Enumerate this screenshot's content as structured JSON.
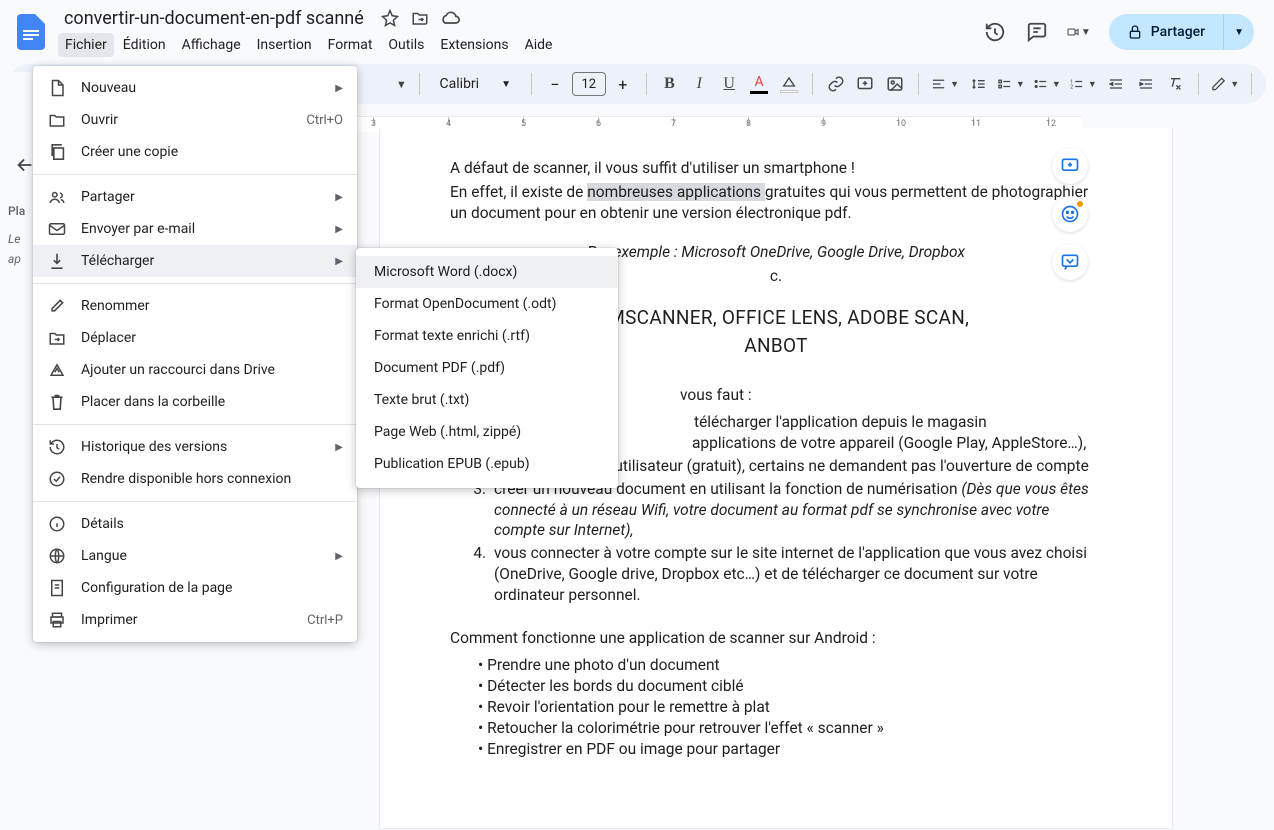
{
  "doc": {
    "title": "convertir-un-document-en-pdf scanné"
  },
  "menubar": [
    "Fichier",
    "Édition",
    "Affichage",
    "Insertion",
    "Format",
    "Outils",
    "Extensions",
    "Aide"
  ],
  "share": {
    "label": "Partager"
  },
  "toolbar": {
    "font": "Calibri",
    "size": "12"
  },
  "leftPanel": {
    "header": "Pla",
    "line1": "Le",
    "line2": "ap"
  },
  "fileMenu": {
    "new": "Nouveau",
    "open": "Ouvrir",
    "open_sc": "Ctrl+O",
    "copy": "Créer une copie",
    "share": "Partager",
    "email": "Envoyer par e-mail",
    "download": "Télécharger",
    "rename": "Renommer",
    "move": "Déplacer",
    "shortcut": "Ajouter un raccourci dans Drive",
    "trash": "Placer dans la corbeille",
    "versions": "Historique des versions",
    "offline": "Rendre disponible hors connexion",
    "details": "Détails",
    "language": "Langue",
    "page_setup": "Configuration de la page",
    "print": "Imprimer",
    "print_sc": "Ctrl+P"
  },
  "downloadMenu": {
    "docx": "Microsoft Word (.docx)",
    "odt": "Format OpenDocument (.odt)",
    "rtf": "Format texte enrichi (.rtf)",
    "pdf": "Document PDF (.pdf)",
    "txt": "Texte brut (.txt)",
    "html": "Page Web (.html, zippé)",
    "epub": "Publication EPUB (.epub)"
  },
  "doc_content": {
    "p1": "A défaut de scanner, il vous suffit d'utiliser un smartphone !",
    "p2a": "En effet, il existe de ",
    "p2b": "nombreuses applications ",
    "p2c": "gratuites qui vous permettent de photographier un document pour en obtenir une version électronique pdf.",
    "example": "Par exemple : Microsoft OneDrive, Google Drive, Dropbox",
    "trailing_c": "c.",
    "big1": "CAMSCANNER, OFFICE LENS, ADOBE SCAN,",
    "big2": "ANBOT",
    "h_need": "vous faut :",
    "li1a": "télécharger l'application depuis le magasin",
    "li1b": "applications de votre appareil (Google Play, AppleStore…),",
    "li2a": "ouvrir un compte utilisateur (gratuit), ",
    "li2b": "certains ne demandent pas l'ouverture de compte",
    "li3a": "créer un nouveau document en utilisant la fonction de numérisation ",
    "li3b": "(Dès que vous êtes connecté à un réseau Wifi, votre document au format pdf se synchronise avec votre compte sur Internet),",
    "li4": "vous connecter à votre compte sur le site internet de l'application que vous avez choisi (OneDrive, Google drive, Dropbox etc…) et de télécharger ce document sur  votre ordinateur personnel.",
    "h_android": "Comment fonctionne une application de scanner sur Android :",
    "b1": "Prendre une photo d'un document",
    "b2": "Détecter les bords du document ciblé",
    "b3": "Revoir l'orientation pour le remettre à plat",
    "b4": "Retoucher la colorimétrie pour retrouver l'effet « scanner »",
    "b5": "Enregistrer en PDF ou image pour partager"
  }
}
